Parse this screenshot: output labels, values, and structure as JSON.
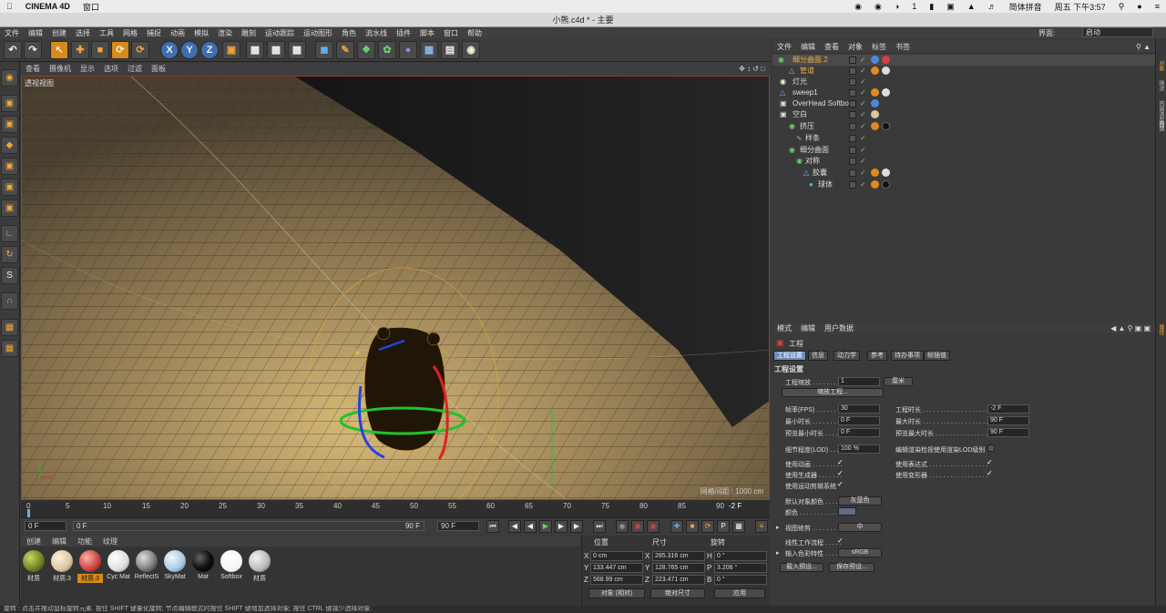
{
  "mac_menu": {
    "app": "CINEMA 4D",
    "items": [
      "窗口"
    ],
    "right_items": [
      "1",
      "简体拼音",
      "周五 下午3:57"
    ]
  },
  "window_title": "小熊.c4d * - 主要",
  "c4d_menu": [
    "文件",
    "编辑",
    "创建",
    "选择",
    "工具",
    "网格",
    "捕捉",
    "动画",
    "模拟",
    "渲染",
    "雕刻",
    "运动跟踪",
    "运动图形",
    "角色",
    "流水线",
    "插件",
    "脚本",
    "窗口",
    "帮助"
  ],
  "layout": {
    "label": "界面:",
    "value": "启动"
  },
  "toolbar": {
    "x": "X",
    "y": "Y",
    "z": "Z"
  },
  "viewport": {
    "menu": [
      "查看",
      "摄像机",
      "显示",
      "选项",
      "过滤",
      "面板"
    ],
    "label": "透视视图",
    "grid_label": "网格间距 : 1000 cm"
  },
  "timeline": {
    "ticks": [
      "0",
      "5",
      "10",
      "15",
      "20",
      "25",
      "30",
      "35",
      "40",
      "45",
      "50",
      "55",
      "60",
      "65",
      "70",
      "75",
      "80",
      "85",
      "90"
    ],
    "end_label": "-2 F",
    "start_field": "0 F",
    "current_field": "0 F",
    "range_end": "90 F",
    "end_field": "90 F"
  },
  "materials": {
    "menu": [
      "创建",
      "编辑",
      "功能",
      "纹理"
    ],
    "items": [
      {
        "name": "材质",
        "color": "#6b7d1e"
      },
      {
        "name": "材质.3",
        "color": "#d9c4a0"
      },
      {
        "name": "材质.3",
        "color": "#c84040"
      },
      {
        "name": "Cyc Mat",
        "color": "#dddddd"
      },
      {
        "name": "ReflectS",
        "color": "#888888"
      },
      {
        "name": "SkyMat",
        "color": "#a8c8e0"
      },
      {
        "name": "Mat",
        "color": "#111111"
      },
      {
        "name": "Softbox",
        "color": "#f4f4f4"
      },
      {
        "name": "材质",
        "color": "#b8b8b8"
      }
    ]
  },
  "coords": {
    "headers": [
      "位置",
      "尺寸",
      "旋转"
    ],
    "rows": [
      {
        "axis": "X",
        "pos": "0 cm",
        "size_axis": "X",
        "size": "285.316 cm",
        "rot_axis": "H",
        "rot": "0 °"
      },
      {
        "axis": "Y",
        "pos": "133.447 cm",
        "size_axis": "Y",
        "size": "128.765 cm",
        "rot_axis": "P",
        "rot": "3.206 °"
      },
      {
        "axis": "Z",
        "pos": "568.99 cm",
        "size_axis": "Z",
        "size": "223.471 cm",
        "rot_axis": "B",
        "rot": "0 °"
      }
    ],
    "mode": "对象 (相对)",
    "size_mode": "绝对尺寸",
    "apply": "应用"
  },
  "status": "旋转 : 点击并拖动鼠标旋转元素. 按住 SHIFT 键量化旋转; 节点编辑模式时按住 SHIFT 键增加选择对象; 按住 CTRL 键减少选择对象.",
  "object_manager": {
    "menu": [
      "文件",
      "编辑",
      "查看",
      "对象",
      "标签",
      "书签"
    ],
    "objects": [
      {
        "name": "细分曲面.2",
        "indent": 0,
        "color": "#f0b040",
        "tags": [
          "#4a8ad8",
          "#d84040"
        ]
      },
      {
        "name": "管道",
        "indent": 1,
        "color": "#f0b040",
        "tags": [
          "#e08a20",
          "#dddddd"
        ]
      },
      {
        "name": "灯光",
        "indent": 0,
        "color": "#ddd",
        "tags": []
      },
      {
        "name": "sweep1",
        "indent": 0,
        "color": "#ddd",
        "tags": [
          "#e08a20",
          "#dddddd"
        ]
      },
      {
        "name": "OverHead Softbox",
        "indent": 0,
        "color": "#ddd",
        "tags": [
          "#4a8ad8"
        ]
      },
      {
        "name": "空白",
        "indent": 0,
        "color": "#ddd",
        "tags": [
          "#d9c4a0"
        ]
      },
      {
        "name": "挤压",
        "indent": 1,
        "color": "#ddd",
        "tags": [
          "#e08a20",
          "#111111"
        ]
      },
      {
        "name": "样条",
        "indent": 2,
        "color": "#ddd",
        "tags": []
      },
      {
        "name": "细分曲面",
        "indent": 1,
        "color": "#ddd",
        "tags": []
      },
      {
        "name": "对称",
        "indent": 2,
        "color": "#ddd",
        "tags": []
      },
      {
        "name": "胶囊",
        "indent": 3,
        "color": "#ddd",
        "tags": [
          "#e08a20",
          "#dddddd"
        ]
      },
      {
        "name": "球体",
        "indent": 4,
        "color": "#ddd",
        "tags": [
          "#e08a20",
          "#111111"
        ]
      }
    ]
  },
  "side_tabs": [
    "对象",
    "场次",
    "内容浏览器",
    "构造"
  ],
  "attr_side_tab": "属性",
  "attributes": {
    "menu": [
      "模式",
      "编辑",
      "用户数据"
    ],
    "heading": "工程",
    "tabs": [
      "工程设置",
      "信息",
      "动力学",
      "参考",
      "待办事项",
      "帧插值"
    ],
    "section": "工程设置",
    "scale_label": "工程缩放 . . . . . . . .",
    "scale_value": "1",
    "scale_unit": "厘米",
    "scale_button": "缩放工程...",
    "fps_label": "帧率(FPS) . . . . . . . .",
    "fps_value": "30",
    "min_label": "最小时长 . . . . . . . .",
    "min_value": "0 F",
    "preview_min_label": "预览最小时长 . . . . .",
    "preview_min_value": "0 F",
    "duration_label": "工程时长 . . . . . . . . . . . . . . . . . . .",
    "duration_value": "-2 F",
    "max_label": "最大时长 . . . . . . . . . . . . . . . . . . .",
    "max_value": "90 F",
    "preview_max_label": "预览最大时长 . . . . . . . . . . . . . . . .",
    "preview_max_value": "90 F",
    "lod_label": "细节程度(LOD) . . . . .",
    "lod_value": "100 %",
    "lod_check_label": "编辑渲染检视使用渲染LOD级别",
    "use_anim": "使用动画 . . . . . . . . .",
    "use_gen": "使用生成器 . . . . . . .",
    "use_motion": "使用运动剪辑系统",
    "use_expr": "使用表达式 . . . . . . . . . . . . . . . . .",
    "use_deform": "使用变形器 . . . . . . . . . . . . . . . . .",
    "default_color_label": "默认对象颜色 . . . .",
    "default_color_value": "灰蓝色",
    "color_label": "颜色 . . . . . . . . . . . .",
    "view_label": "视图修剪 . . . . . . . . .",
    "view_value": "中",
    "linear_label": "线性工作流程 . . . . .",
    "input_label": "输入色彩特性 . . . . .",
    "input_value": "sRGB",
    "load_preset": "载入预设...",
    "save_preset": "保存预设..."
  }
}
